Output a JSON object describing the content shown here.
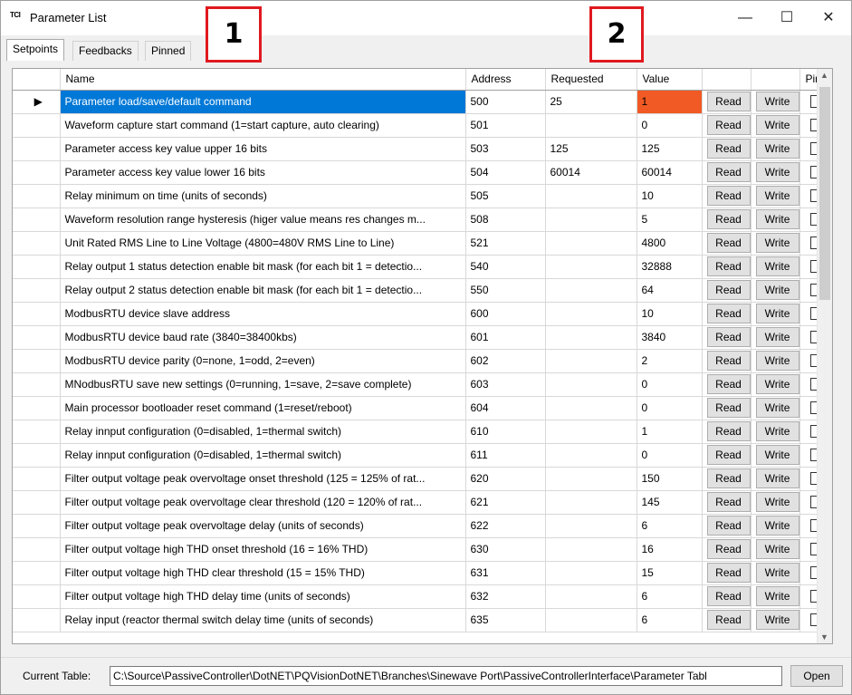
{
  "window": {
    "app_icon_text": "TCI",
    "title": "Parameter List",
    "minimize": "—",
    "maximize": "☐",
    "close": "✕"
  },
  "callouts": [
    "1",
    "2"
  ],
  "tabs": [
    "Setpoints",
    "Feedbacks",
    "Pinned"
  ],
  "columns": {
    "name": "Name",
    "address": "Address",
    "requested": "Requested",
    "value": "Value",
    "pin": "Pin"
  },
  "buttons": {
    "read": "Read",
    "write": "Write",
    "open": "Open"
  },
  "row_pointer": "▶",
  "rows": [
    {
      "name": "Parameter load/save/default command",
      "address": "500",
      "requested": "25",
      "value": "1"
    },
    {
      "name": "Waveform capture start command (1=start capture, auto clearing)",
      "address": "501",
      "requested": "",
      "value": "0"
    },
    {
      "name": "Parameter access key value upper 16 bits",
      "address": "503",
      "requested": "125",
      "value": "125"
    },
    {
      "name": "Parameter access key value lower 16 bits",
      "address": "504",
      "requested": "60014",
      "value": "60014"
    },
    {
      "name": "Relay minimum on time (units of seconds)",
      "address": "505",
      "requested": "",
      "value": "10"
    },
    {
      "name": "Waveform resolution range hysteresis (higer value means res changes m...",
      "address": "508",
      "requested": "",
      "value": "5"
    },
    {
      "name": "Unit Rated RMS Line to Line Voltage (4800=480V RMS Line to Line)",
      "address": "521",
      "requested": "",
      "value": "4800"
    },
    {
      "name": "Relay output 1 status detection enable bit mask (for each bit 1 = detectio...",
      "address": "540",
      "requested": "",
      "value": "32888"
    },
    {
      "name": "Relay output 2 status detection enable bit mask (for each bit 1 = detectio...",
      "address": "550",
      "requested": "",
      "value": "64"
    },
    {
      "name": "ModbusRTU device slave address",
      "address": "600",
      "requested": "",
      "value": "10"
    },
    {
      "name": "ModbusRTU device baud rate (3840=38400kbs)",
      "address": "601",
      "requested": "",
      "value": "3840"
    },
    {
      "name": "ModbusRTU device parity (0=none, 1=odd, 2=even)",
      "address": "602",
      "requested": "",
      "value": "2"
    },
    {
      "name": "MNodbusRTU save new settings (0=running, 1=save, 2=save complete)",
      "address": "603",
      "requested": "",
      "value": "0"
    },
    {
      "name": "Main processor bootloader reset command (1=reset/reboot)",
      "address": "604",
      "requested": "",
      "value": "0"
    },
    {
      "name": "Relay innput configuration (0=disabled, 1=thermal switch)",
      "address": "610",
      "requested": "",
      "value": "1"
    },
    {
      "name": "Relay innput configuration (0=disabled, 1=thermal switch)",
      "address": "611",
      "requested": "",
      "value": "0"
    },
    {
      "name": "Filter output voltage peak overvoltage onset threshold (125 = 125% of rat...",
      "address": "620",
      "requested": "",
      "value": "150"
    },
    {
      "name": "Filter output voltage peak overvoltage clear threshold  (120 = 120% of rat...",
      "address": "621",
      "requested": "",
      "value": "145"
    },
    {
      "name": "Filter output voltage peak overvoltage delay (units of seconds)",
      "address": "622",
      "requested": "",
      "value": "6"
    },
    {
      "name": "Filter output voltage high THD onset threshold (16 = 16% THD)",
      "address": "630",
      "requested": "",
      "value": "16"
    },
    {
      "name": "Filter output voltage high THD clear threshold (15 = 15% THD)",
      "address": "631",
      "requested": "",
      "value": "15"
    },
    {
      "name": "Filter output voltage high THD delay time (units of seconds)",
      "address": "632",
      "requested": "",
      "value": "6"
    },
    {
      "name": "Relay input (reactor thermal switch delay time (units of seconds)",
      "address": "635",
      "requested": "",
      "value": "6"
    }
  ],
  "bottom": {
    "label": "Current Table:",
    "path": "C:\\Source\\PassiveController\\DotNET\\PQVisionDotNET\\Branches\\Sinewave Port\\PassiveControllerInterface\\Parameter Tabl"
  },
  "colors": {
    "selection": "#0078d7",
    "value_highlight": "#f15a24",
    "callout_border": "#e0191f"
  }
}
